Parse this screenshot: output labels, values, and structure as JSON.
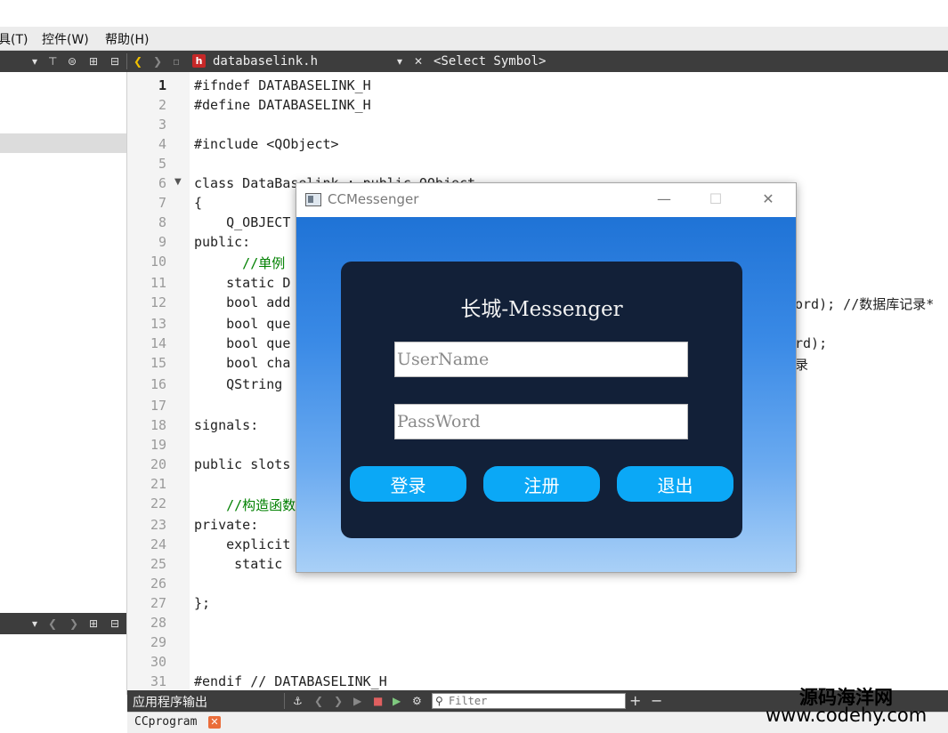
{
  "menubar": {
    "items": [
      "具(T)",
      "控件(W)",
      "帮助(H)"
    ]
  },
  "editor_toolbar": {
    "file_badge": "h",
    "file_name": "databaselink.h",
    "symbol_selector": "<Select Symbol>"
  },
  "code": {
    "lines": [
      {
        "no": "1",
        "text": "#ifndef DATABASELINK_H"
      },
      {
        "no": "2",
        "text": "#define DATABASELINK_H"
      },
      {
        "no": "3",
        "text": ""
      },
      {
        "no": "4",
        "text": "#include <QObject>"
      },
      {
        "no": "5",
        "text": ""
      },
      {
        "no": "6",
        "text": "class DataBaselink : public QObject"
      },
      {
        "no": "7",
        "text": "{"
      },
      {
        "no": "8",
        "text": "    Q_OBJECT"
      },
      {
        "no": "9",
        "text": "public:"
      },
      {
        "no": "10",
        "text": "      //单例"
      },
      {
        "no": "11",
        "text": "    static D"
      },
      {
        "no": "12",
        "text": "    bool add"
      },
      {
        "no": "13",
        "text": "    bool que"
      },
      {
        "no": "14",
        "text": "    bool que"
      },
      {
        "no": "15",
        "text": "    bool cha"
      },
      {
        "no": "16",
        "text": "    QString"
      },
      {
        "no": "17",
        "text": ""
      },
      {
        "no": "18",
        "text": "signals:"
      },
      {
        "no": "19",
        "text": ""
      },
      {
        "no": "20",
        "text": "public slots"
      },
      {
        "no": "21",
        "text": ""
      },
      {
        "no": "22",
        "text": "    //构造函数"
      },
      {
        "no": "23",
        "text": "private:"
      },
      {
        "no": "24",
        "text": "    explicit"
      },
      {
        "no": "25",
        "text": "     static"
      },
      {
        "no": "26",
        "text": ""
      },
      {
        "no": "27",
        "text": "};"
      },
      {
        "no": "28",
        "text": ""
      },
      {
        "no": "29",
        "text": ""
      },
      {
        "no": "30",
        "text": ""
      },
      {
        "no": "31",
        "text": "#endif // DATABASELINK_H"
      }
    ],
    "right_fragments": [
      "ord); //数据库记录*",
      "rd);",
      "录"
    ]
  },
  "dialog": {
    "title": "CCMessenger",
    "heading": "长城-Messenger",
    "username_placeholder": "UserName",
    "password_placeholder": "PassWord",
    "buttons": {
      "login": "登录",
      "register": "注册",
      "exit": "退出"
    },
    "window_controls": {
      "minimize": "—",
      "maximize": "☐",
      "close": "✕"
    }
  },
  "output_panel": {
    "title": "应用程序输出",
    "filter_placeholder": "Filter",
    "tab_label": "CCprogram"
  },
  "watermark": {
    "cn": "源码海洋网",
    "url": "www.codehy.com"
  }
}
